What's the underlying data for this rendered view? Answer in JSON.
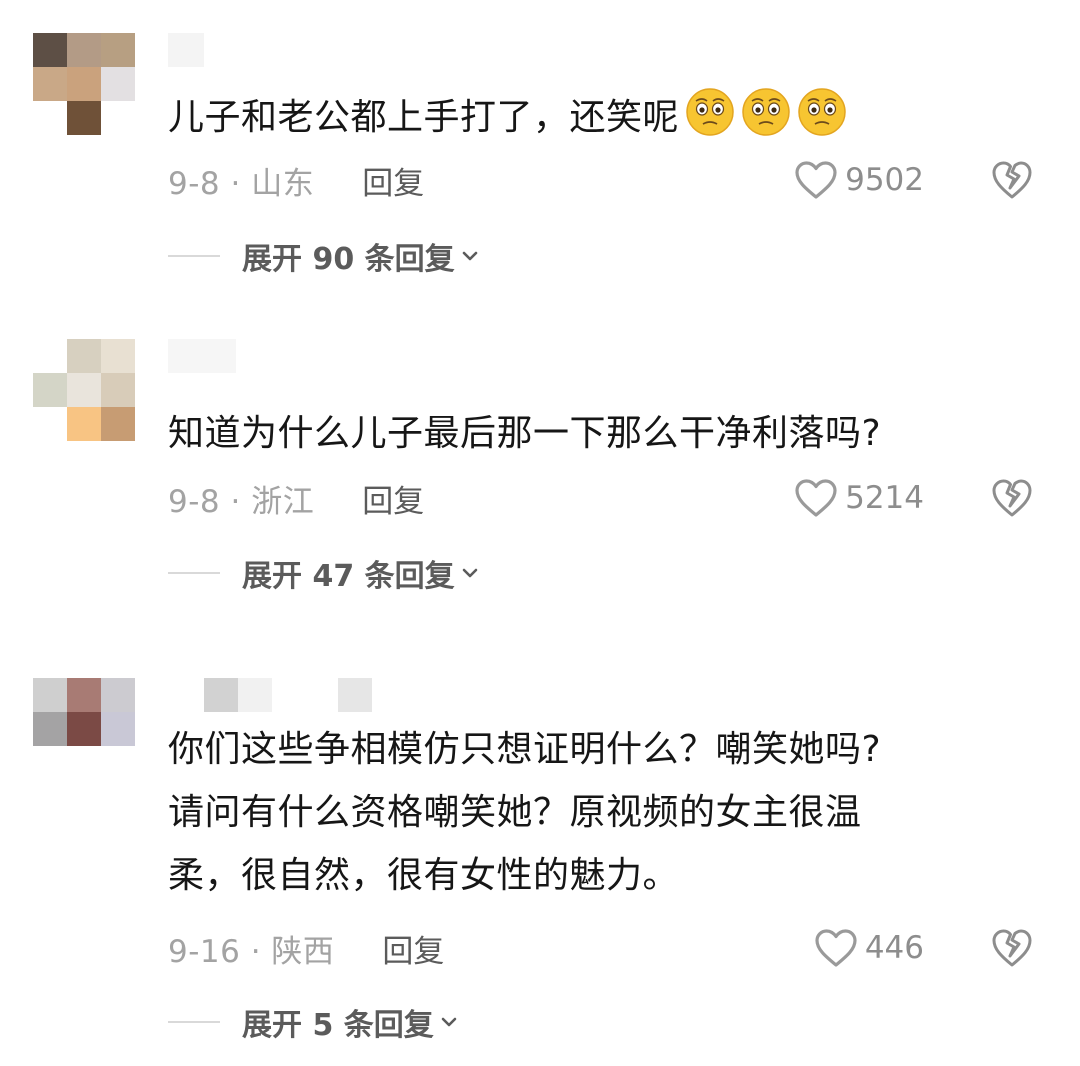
{
  "comments": [
    {
      "text": "儿子和老公都上手打了，还笑呢",
      "emojis": [
        "pleading-face-emoji",
        "pleading-face-emoji",
        "pleading-face-emoji"
      ],
      "date_region": "9-8 · 山东",
      "reply_label": "回复",
      "like_count": "9502",
      "expand_label": "展开 90 条回复"
    },
    {
      "text": "知道为什么儿子最后那一下那么干净利落吗?",
      "emojis": [],
      "date_region": "9-8 · 浙江",
      "reply_label": "回复",
      "like_count": "5214",
      "expand_label": "展开 47 条回复"
    },
    {
      "text": "你们这些争相模仿只想证明什么？嘲笑她吗?\n请问有什么资格嘲笑她？原视频的女主很温\n柔，很自然，很有女性的魅力。",
      "emojis": [],
      "date_region": "9-16 · 陕西",
      "reply_label": "回复",
      "like_count": "446",
      "expand_label": "展开 5 条回复"
    }
  ],
  "colors": {
    "text": "#161616",
    "meta": "#a3a3a3",
    "action": "#5b5b5b",
    "emoji_yellow": "#f7c531"
  },
  "icons": {
    "like": "heart-outline-icon",
    "dislike": "broken-heart-icon",
    "expand": "chevron-down-icon"
  }
}
